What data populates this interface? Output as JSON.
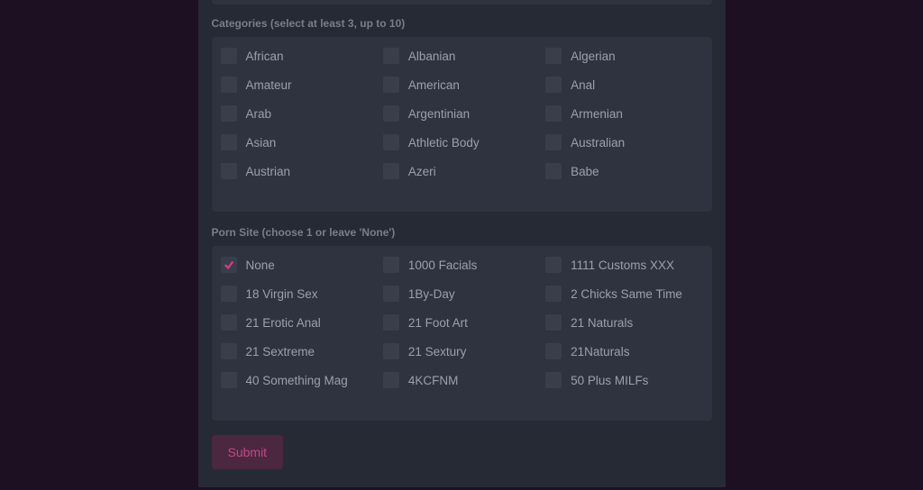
{
  "categories": {
    "label": "Categories (select at least 3, up to 10)",
    "items": [
      {
        "label": "African",
        "checked": false
      },
      {
        "label": "Albanian",
        "checked": false
      },
      {
        "label": "Algerian",
        "checked": false
      },
      {
        "label": "Amateur",
        "checked": false
      },
      {
        "label": "American",
        "checked": false
      },
      {
        "label": "Anal",
        "checked": false
      },
      {
        "label": "Arab",
        "checked": false
      },
      {
        "label": "Argentinian",
        "checked": false
      },
      {
        "label": "Armenian",
        "checked": false
      },
      {
        "label": "Asian",
        "checked": false
      },
      {
        "label": "Athletic Body",
        "checked": false
      },
      {
        "label": "Australian",
        "checked": false
      },
      {
        "label": "Austrian",
        "checked": false
      },
      {
        "label": "Azeri",
        "checked": false
      },
      {
        "label": "Babe",
        "checked": false
      }
    ]
  },
  "sites": {
    "label": "Porn Site (choose 1 or leave 'None')",
    "items": [
      {
        "label": "None",
        "checked": true
      },
      {
        "label": "1000 Facials",
        "checked": false
      },
      {
        "label": "1111 Customs XXX",
        "checked": false
      },
      {
        "label": "18 Virgin Sex",
        "checked": false
      },
      {
        "label": "1By-Day",
        "checked": false
      },
      {
        "label": "2 Chicks Same Time",
        "checked": false
      },
      {
        "label": "21 Erotic Anal",
        "checked": false
      },
      {
        "label": "21 Foot Art",
        "checked": false
      },
      {
        "label": "21 Naturals",
        "checked": false
      },
      {
        "label": "21 Sextreme",
        "checked": false
      },
      {
        "label": "21 Sextury",
        "checked": false
      },
      {
        "label": "21Naturals",
        "checked": false
      },
      {
        "label": "40 Something Mag",
        "checked": false
      },
      {
        "label": "4KCFNM",
        "checked": false
      },
      {
        "label": "50 Plus MILFs",
        "checked": false
      }
    ]
  },
  "submit_label": "Submit"
}
